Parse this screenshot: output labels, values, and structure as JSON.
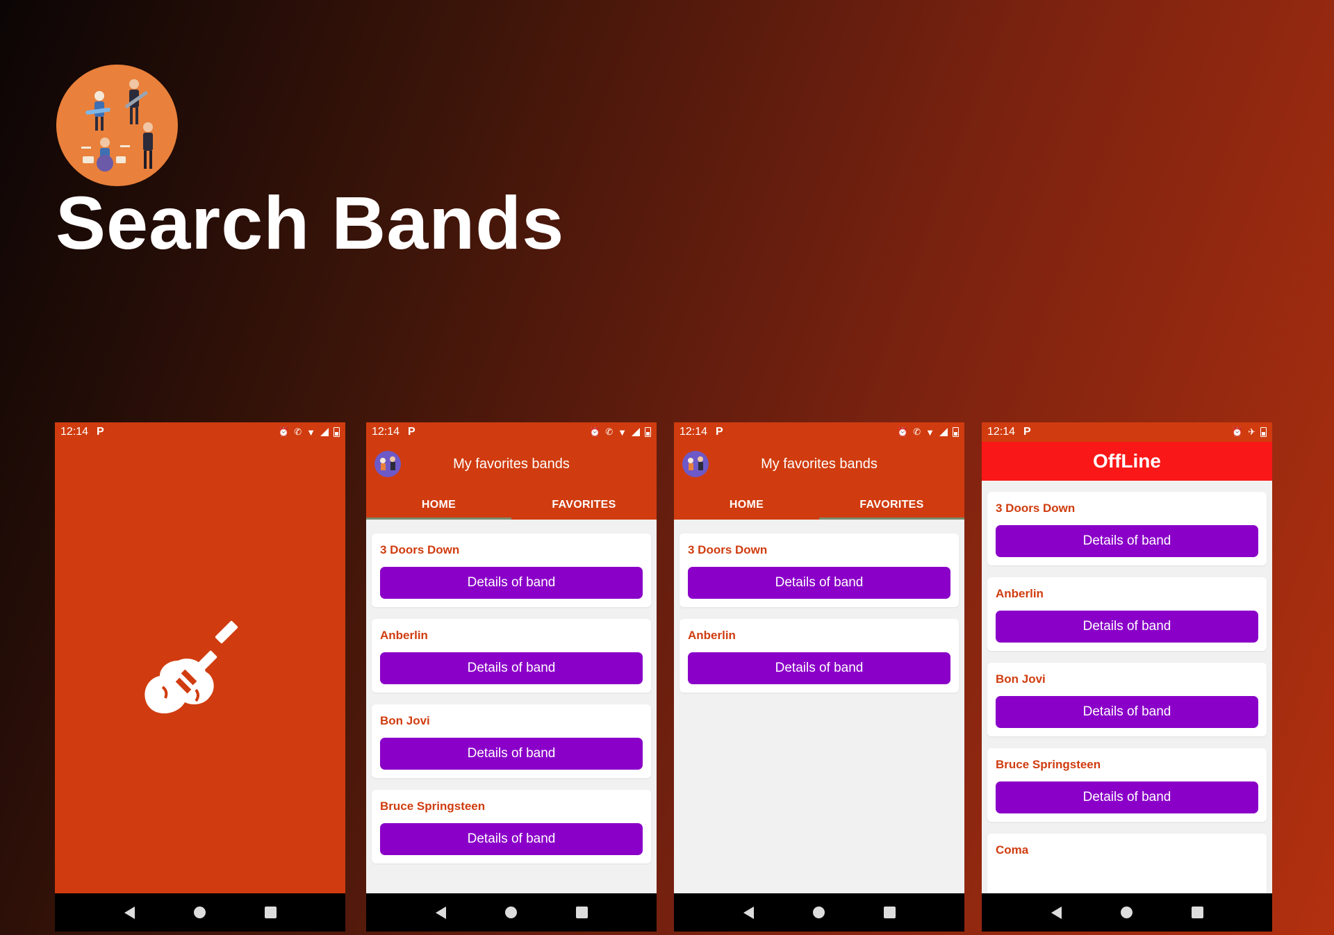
{
  "page": {
    "title": "Search Bands",
    "logo_icon": "band-musicians-icon"
  },
  "status": {
    "time": "12:14",
    "p_icon": "P"
  },
  "app": {
    "title": "My favorites bands",
    "tabs": {
      "home": "HOME",
      "favorites": "FAVORITES"
    },
    "details_label": "Details of band"
  },
  "bands": [
    "3 Doors Down",
    "Anberlin",
    "Bon Jovi",
    "Bruce Springsteen",
    "Coma"
  ],
  "offline": {
    "title": "OffLine"
  },
  "colors": {
    "primary": "#d03c0f",
    "button": "#8a00c8",
    "offline_bar": "#fa1717",
    "tab_indicator": "#7b8c70"
  }
}
